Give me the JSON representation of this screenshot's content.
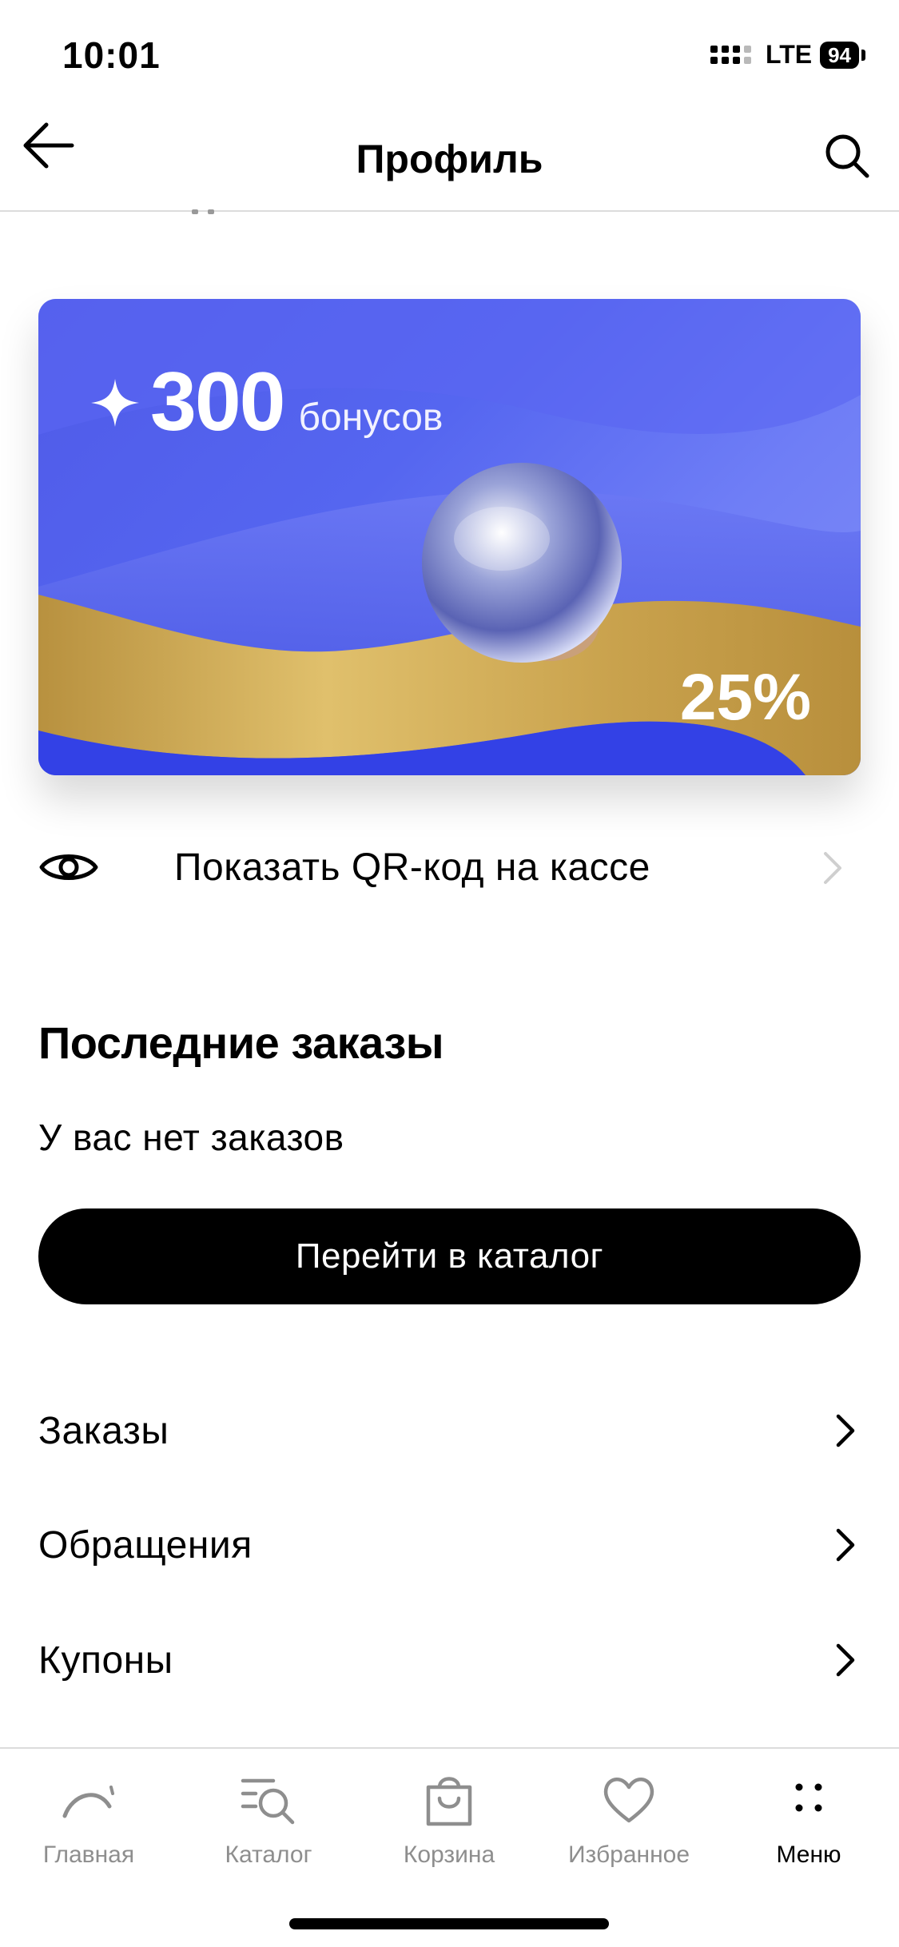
{
  "status_bar": {
    "time": "10:01",
    "network": "LTE",
    "battery": "94"
  },
  "header": {
    "title": "Профиль"
  },
  "bonus_card": {
    "amount": "300",
    "unit": "бонусов",
    "percent": "25%"
  },
  "qr": {
    "label": "Показать QR-код на кассе"
  },
  "orders": {
    "title": "Последние заказы",
    "empty_text": "У вас нет заказов",
    "catalog_button": "Перейти в каталог"
  },
  "menu": [
    {
      "label": "Заказы"
    },
    {
      "label": "Обращения"
    },
    {
      "label": "Купоны"
    }
  ],
  "tabbar": [
    {
      "label": "Главная",
      "icon": "home-arc-icon"
    },
    {
      "label": "Каталог",
      "icon": "catalog-search-icon"
    },
    {
      "label": "Корзина",
      "icon": "bag-icon"
    },
    {
      "label": "Избранное",
      "icon": "heart-icon"
    },
    {
      "label": "Меню",
      "icon": "menu-dots-icon",
      "active": true
    }
  ],
  "colors": {
    "card_blue": "#5566f0",
    "card_gold": "#c9a24d",
    "inactive_tab": "#8e8e8e"
  }
}
